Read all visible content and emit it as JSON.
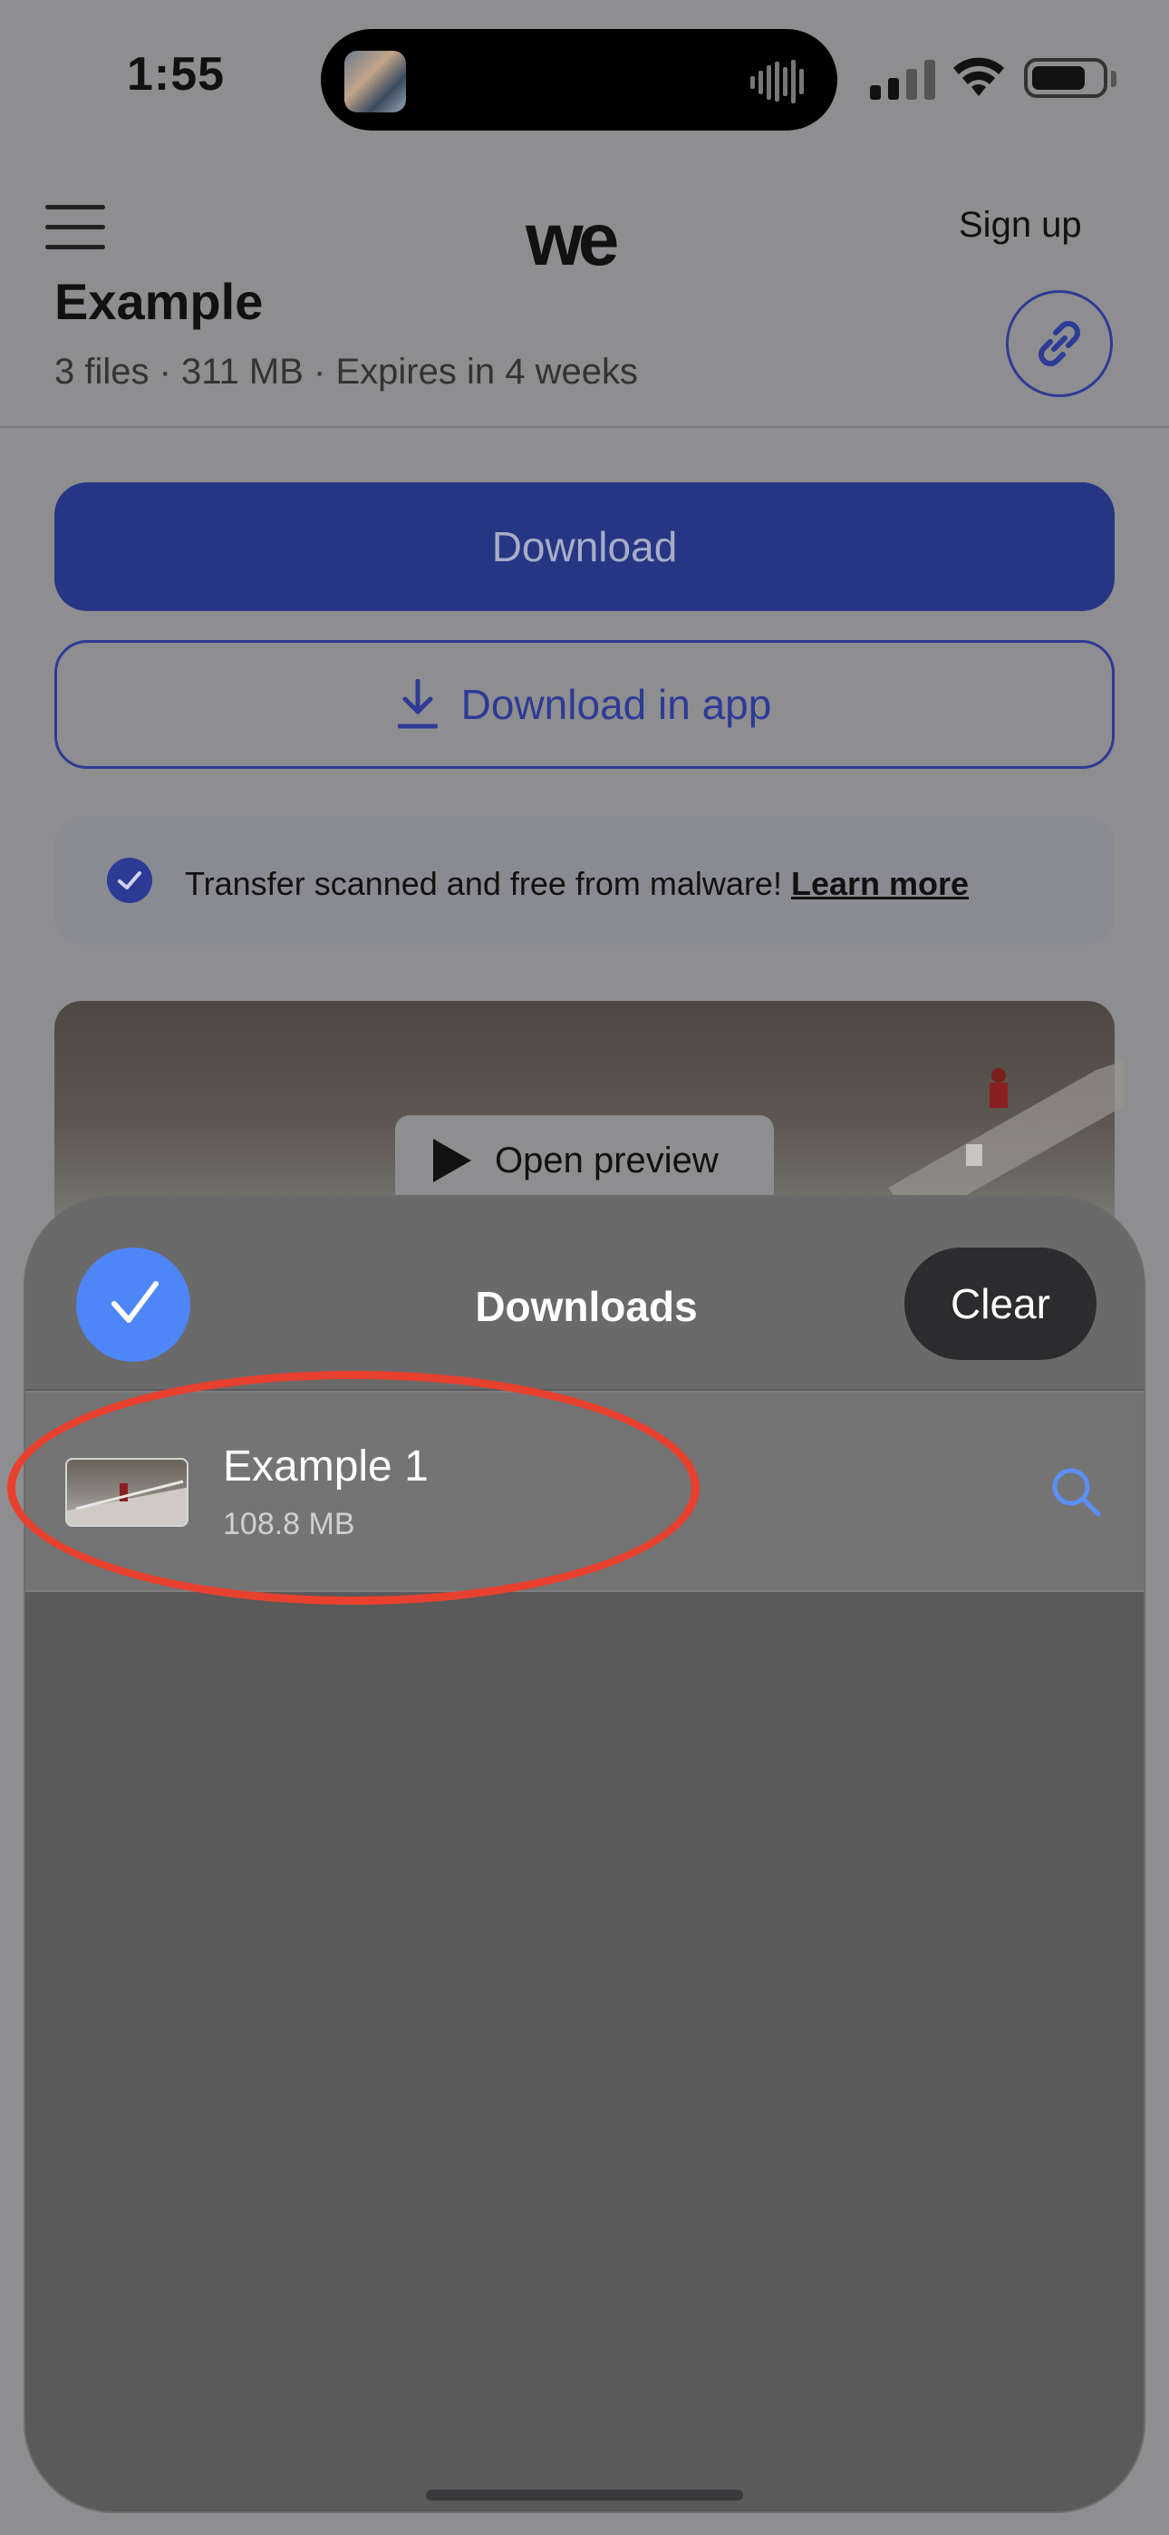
{
  "status_bar": {
    "time": "1:55"
  },
  "header": {
    "logo": "we",
    "signup_label": "Sign up"
  },
  "transfer": {
    "title": "Example",
    "meta": "3 files · 311 MB · Expires in 4 weeks"
  },
  "actions": {
    "download_label": "Download",
    "download_app_label": "Download in app"
  },
  "scan_notice": {
    "text": "Transfer scanned and free from malware!",
    "link_label": "Learn more"
  },
  "preview": {
    "open_label": "Open preview"
  },
  "downloads_sheet": {
    "title": "Downloads",
    "clear_label": "Clear",
    "items": [
      {
        "name": "Example 1",
        "size": "108.8 MB"
      }
    ]
  },
  "colors": {
    "accent": "#263685",
    "sheet_check": "#4f86f7",
    "annotation": "#e8402e"
  },
  "icons": [
    "menu-icon",
    "link-icon",
    "download-arrow-icon",
    "checkmark-icon",
    "play-icon",
    "search-icon"
  ]
}
